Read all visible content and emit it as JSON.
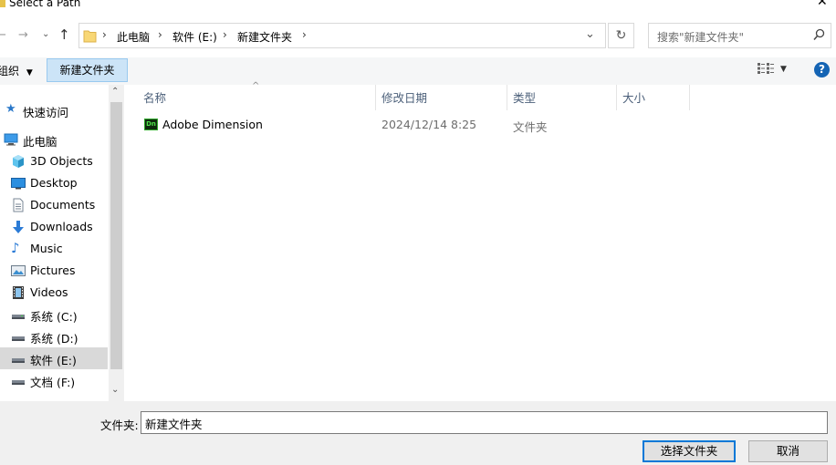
{
  "window": {
    "title": "Select a Path"
  },
  "nav": {
    "back_icon": "arrow-left-icon",
    "forward_icon": "arrow-right-icon",
    "recent_icon": "chevron-down-icon",
    "up_icon": "arrow-up-icon"
  },
  "address": {
    "segments": [
      "此电脑",
      "软件 (E:)",
      "新建文件夹"
    ]
  },
  "search": {
    "placeholder": "搜索\"新建文件夹\""
  },
  "toolbar": {
    "organize_label": "组织",
    "new_folder_label": "新建文件夹"
  },
  "sidebar": {
    "items": [
      {
        "label": "快速访问",
        "icon": "star-icon"
      },
      {
        "label": "此电脑",
        "icon": "computer-icon"
      },
      {
        "label": "3D Objects",
        "icon": "cube-icon"
      },
      {
        "label": "Desktop",
        "icon": "desktop-icon"
      },
      {
        "label": "Documents",
        "icon": "document-icon"
      },
      {
        "label": "Downloads",
        "icon": "download-icon"
      },
      {
        "label": "Music",
        "icon": "music-note-icon"
      },
      {
        "label": "Pictures",
        "icon": "picture-icon"
      },
      {
        "label": "Videos",
        "icon": "film-icon"
      },
      {
        "label": "系统 (C:)",
        "icon": "drive-icon"
      },
      {
        "label": "系统 (D:)",
        "icon": "drive-icon"
      },
      {
        "label": "软件 (E:)",
        "icon": "drive-icon"
      },
      {
        "label": "文档 (F:)",
        "icon": "drive-icon"
      }
    ]
  },
  "columns": {
    "name": "名称",
    "date": "修改日期",
    "type": "类型",
    "size": "大小"
  },
  "files": [
    {
      "icon_text": "Dn",
      "name": "Adobe Dimension",
      "date": "2024/12/14 8:25",
      "type": "文件夹",
      "size": ""
    }
  ],
  "footer": {
    "filename_label": "文件夹:",
    "filename_value": "新建文件夹",
    "select_button": "选择文件夹",
    "cancel_button": "取消"
  },
  "colors": {
    "accent": "#0078d7",
    "selected_bg": "#cce4f7",
    "column_header": "#4c607a"
  }
}
